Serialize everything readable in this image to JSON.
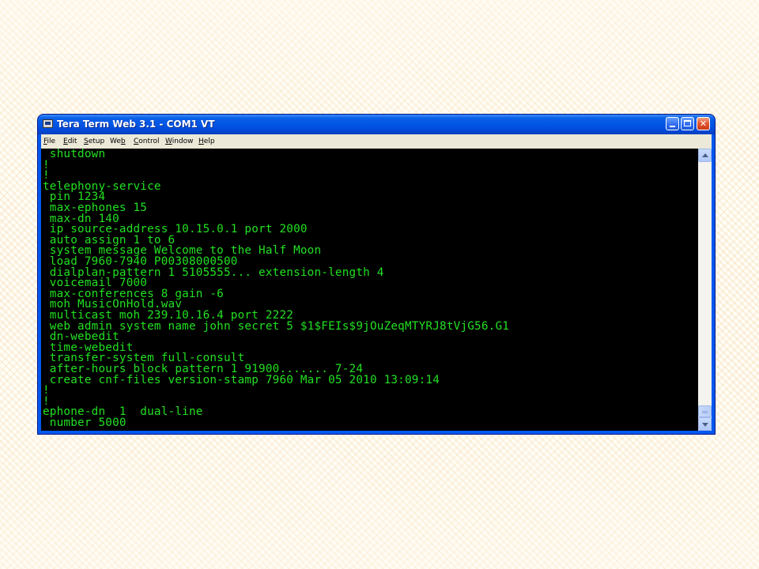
{
  "window": {
    "title": "Tera Term Web 3.1 - COM1 VT",
    "icons": {
      "app": "terminal-icon",
      "minimize": "minimize-icon",
      "maximize": "maximize-icon",
      "close": "close-icon"
    },
    "close_glyph": "✕"
  },
  "menu": {
    "items": [
      {
        "first": "F",
        "rest": "ile"
      },
      {
        "first": "E",
        "rest": "dit"
      },
      {
        "first": "S",
        "rest": "etup"
      },
      {
        "first": "",
        "pre": "We",
        "u": "b",
        "rest": ""
      },
      {
        "first": "C",
        "rest": "ontrol"
      },
      {
        "first": "W",
        "rest": "indow"
      },
      {
        "first": "H",
        "rest": "elp"
      }
    ]
  },
  "terminal": {
    "text_color": "#22e022",
    "background": "#000000",
    "lines": [
      " shutdown",
      "!",
      "!",
      "telephony-service",
      " pin 1234",
      " max-ephones 15",
      " max-dn 140",
      " ip source-address 10.15.0.1 port 2000",
      " auto assign 1 to 6",
      " system message Welcome to the Half Moon",
      " load 7960-7940 P00308000500",
      " dialplan-pattern 1 5105555... extension-length 4",
      " voicemail 7000",
      " max-conferences 8 gain -6",
      " moh MusicOnHold.wav",
      " multicast moh 239.10.16.4 port 2222",
      " web admin system name john secret 5 $1$FEIs$9jOuZeqMTYRJ8tVjG56.G1",
      " dn-webedit",
      " time-webedit",
      " transfer-system full-consult",
      " after-hours block pattern 1 91900....... 7-24",
      " create cnf-files version-stamp 7960 Mar 05 2010 13:09:14",
      "!",
      "!",
      "ephone-dn  1  dual-line",
      " number 5000"
    ]
  },
  "scrollbar": {
    "up_icon": "scroll-up-arrow-icon",
    "down_icon": "scroll-down-arrow-icon"
  }
}
